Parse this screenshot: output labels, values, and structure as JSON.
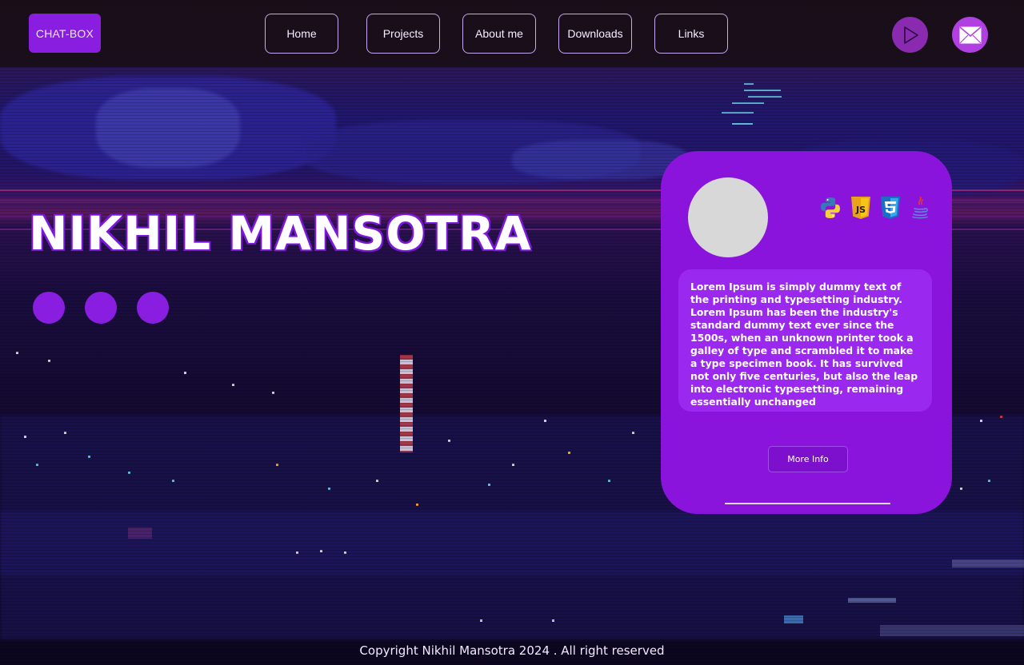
{
  "brand": {
    "label": "CHAT-BOX"
  },
  "nav": {
    "items": [
      {
        "label": "Home"
      },
      {
        "label": "Projects"
      },
      {
        "label": "About me"
      },
      {
        "label": "Downloads"
      },
      {
        "label": "Links"
      }
    ]
  },
  "actions": {
    "play_icon": "play-icon",
    "mail_icon": "mail-icon"
  },
  "hero": {
    "name": "NIKHIL MANSOTRA",
    "dots": 3
  },
  "card": {
    "tech_icons": [
      "python-icon",
      "javascript-icon",
      "css3-icon",
      "java-icon"
    ],
    "description": "Lorem Ipsum is simply dummy text of the printing and typesetting industry. Lorem Ipsum has been the industry's standard dummy text ever since the 1500s, when an unknown printer took a galley of type and scrambled it to make a type specimen book. It has survived not only five centuries, but also the leap into electronic typesetting, remaining essentially unchanged",
    "button_label": "More Info"
  },
  "footer": {
    "copyright": "Copyright Nikhil Mansotra 2024 . All right reserved"
  },
  "colors": {
    "accent": "#8a1ee0",
    "card": "#8a14dc",
    "topbar": "#180e16"
  }
}
